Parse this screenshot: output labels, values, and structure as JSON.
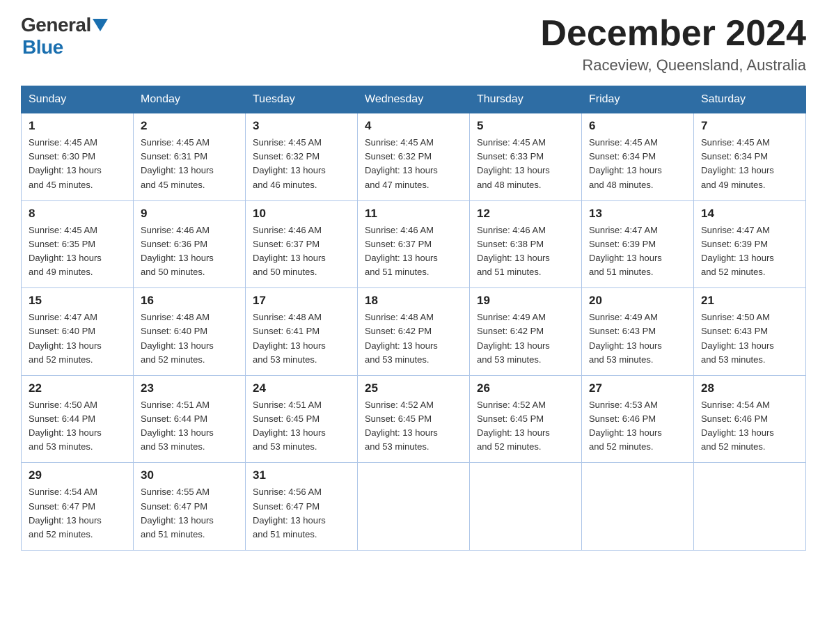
{
  "header": {
    "logo_general": "General",
    "logo_blue": "Blue",
    "month_title": "December 2024",
    "location": "Raceview, Queensland, Australia"
  },
  "days_of_week": [
    "Sunday",
    "Monday",
    "Tuesday",
    "Wednesday",
    "Thursday",
    "Friday",
    "Saturday"
  ],
  "weeks": [
    [
      {
        "day": "1",
        "sunrise": "4:45 AM",
        "sunset": "6:30 PM",
        "daylight": "13 hours and 45 minutes."
      },
      {
        "day": "2",
        "sunrise": "4:45 AM",
        "sunset": "6:31 PM",
        "daylight": "13 hours and 45 minutes."
      },
      {
        "day": "3",
        "sunrise": "4:45 AM",
        "sunset": "6:32 PM",
        "daylight": "13 hours and 46 minutes."
      },
      {
        "day": "4",
        "sunrise": "4:45 AM",
        "sunset": "6:32 PM",
        "daylight": "13 hours and 47 minutes."
      },
      {
        "day": "5",
        "sunrise": "4:45 AM",
        "sunset": "6:33 PM",
        "daylight": "13 hours and 48 minutes."
      },
      {
        "day": "6",
        "sunrise": "4:45 AM",
        "sunset": "6:34 PM",
        "daylight": "13 hours and 48 minutes."
      },
      {
        "day": "7",
        "sunrise": "4:45 AM",
        "sunset": "6:34 PM",
        "daylight": "13 hours and 49 minutes."
      }
    ],
    [
      {
        "day": "8",
        "sunrise": "4:45 AM",
        "sunset": "6:35 PM",
        "daylight": "13 hours and 49 minutes."
      },
      {
        "day": "9",
        "sunrise": "4:46 AM",
        "sunset": "6:36 PM",
        "daylight": "13 hours and 50 minutes."
      },
      {
        "day": "10",
        "sunrise": "4:46 AM",
        "sunset": "6:37 PM",
        "daylight": "13 hours and 50 minutes."
      },
      {
        "day": "11",
        "sunrise": "4:46 AM",
        "sunset": "6:37 PM",
        "daylight": "13 hours and 51 minutes."
      },
      {
        "day": "12",
        "sunrise": "4:46 AM",
        "sunset": "6:38 PM",
        "daylight": "13 hours and 51 minutes."
      },
      {
        "day": "13",
        "sunrise": "4:47 AM",
        "sunset": "6:39 PM",
        "daylight": "13 hours and 51 minutes."
      },
      {
        "day": "14",
        "sunrise": "4:47 AM",
        "sunset": "6:39 PM",
        "daylight": "13 hours and 52 minutes."
      }
    ],
    [
      {
        "day": "15",
        "sunrise": "4:47 AM",
        "sunset": "6:40 PM",
        "daylight": "13 hours and 52 minutes."
      },
      {
        "day": "16",
        "sunrise": "4:48 AM",
        "sunset": "6:40 PM",
        "daylight": "13 hours and 52 minutes."
      },
      {
        "day": "17",
        "sunrise": "4:48 AM",
        "sunset": "6:41 PM",
        "daylight": "13 hours and 53 minutes."
      },
      {
        "day": "18",
        "sunrise": "4:48 AM",
        "sunset": "6:42 PM",
        "daylight": "13 hours and 53 minutes."
      },
      {
        "day": "19",
        "sunrise": "4:49 AM",
        "sunset": "6:42 PM",
        "daylight": "13 hours and 53 minutes."
      },
      {
        "day": "20",
        "sunrise": "4:49 AM",
        "sunset": "6:43 PM",
        "daylight": "13 hours and 53 minutes."
      },
      {
        "day": "21",
        "sunrise": "4:50 AM",
        "sunset": "6:43 PM",
        "daylight": "13 hours and 53 minutes."
      }
    ],
    [
      {
        "day": "22",
        "sunrise": "4:50 AM",
        "sunset": "6:44 PM",
        "daylight": "13 hours and 53 minutes."
      },
      {
        "day": "23",
        "sunrise": "4:51 AM",
        "sunset": "6:44 PM",
        "daylight": "13 hours and 53 minutes."
      },
      {
        "day": "24",
        "sunrise": "4:51 AM",
        "sunset": "6:45 PM",
        "daylight": "13 hours and 53 minutes."
      },
      {
        "day": "25",
        "sunrise": "4:52 AM",
        "sunset": "6:45 PM",
        "daylight": "13 hours and 53 minutes."
      },
      {
        "day": "26",
        "sunrise": "4:52 AM",
        "sunset": "6:45 PM",
        "daylight": "13 hours and 52 minutes."
      },
      {
        "day": "27",
        "sunrise": "4:53 AM",
        "sunset": "6:46 PM",
        "daylight": "13 hours and 52 minutes."
      },
      {
        "day": "28",
        "sunrise": "4:54 AM",
        "sunset": "6:46 PM",
        "daylight": "13 hours and 52 minutes."
      }
    ],
    [
      {
        "day": "29",
        "sunrise": "4:54 AM",
        "sunset": "6:47 PM",
        "daylight": "13 hours and 52 minutes."
      },
      {
        "day": "30",
        "sunrise": "4:55 AM",
        "sunset": "6:47 PM",
        "daylight": "13 hours and 51 minutes."
      },
      {
        "day": "31",
        "sunrise": "4:56 AM",
        "sunset": "6:47 PM",
        "daylight": "13 hours and 51 minutes."
      },
      null,
      null,
      null,
      null
    ]
  ],
  "labels": {
    "sunrise": "Sunrise:",
    "sunset": "Sunset:",
    "daylight": "Daylight:"
  }
}
